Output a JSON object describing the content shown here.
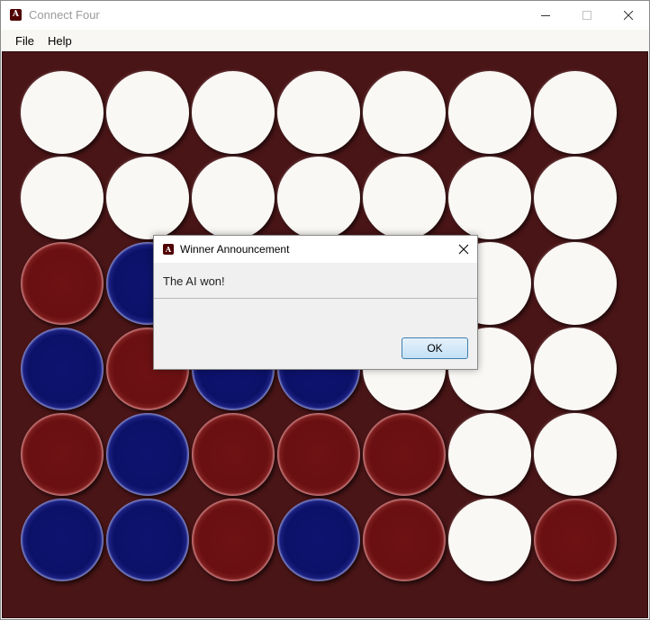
{
  "window": {
    "title": "Connect Four",
    "icon": "texas-am-logo-icon",
    "controls": [
      "minimize-icon",
      "maximize-icon",
      "close-icon"
    ]
  },
  "menu": {
    "items": [
      {
        "label": "File"
      },
      {
        "label": "Help"
      }
    ]
  },
  "board": {
    "rows": 6,
    "cols": 7,
    "colors": {
      "background": "#4a1517",
      "empty": "#faf8f5",
      "red": "#6e1214",
      "blue": "#0e1370"
    },
    "cells": [
      [
        "empty",
        "empty",
        "empty",
        "empty",
        "empty",
        "empty",
        "empty"
      ],
      [
        "empty",
        "empty",
        "empty",
        "empty",
        "empty",
        "empty",
        "empty"
      ],
      [
        "red",
        "blue",
        "blue",
        "empty",
        "empty",
        "empty",
        "empty"
      ],
      [
        "blue",
        "red",
        "blue",
        "blue",
        "empty",
        "empty",
        "empty"
      ],
      [
        "red",
        "blue",
        "red",
        "red",
        "red",
        "empty",
        "empty"
      ],
      [
        "blue",
        "blue",
        "red",
        "blue",
        "red",
        "empty",
        "red"
      ]
    ]
  },
  "dialog": {
    "title": "Winner Announcement",
    "icon": "texas-am-logo-icon",
    "message": "The AI won!",
    "ok_label": "OK"
  }
}
